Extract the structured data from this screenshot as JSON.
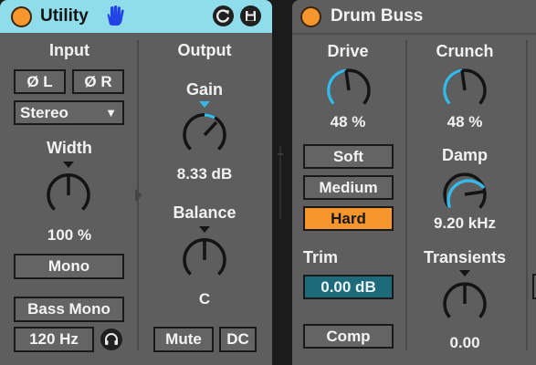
{
  "colors": {
    "accent": "#f7962d",
    "knob_arc": "#37b8e6",
    "header_utility": "#8fdcea",
    "header_drum": "#5e5e5e",
    "panel": "#5e5e5e",
    "teal_field": "#1c6a7a"
  },
  "utility": {
    "title": "Utility",
    "icons": [
      "power-icon",
      "hand-icon",
      "reset-icon",
      "save-icon"
    ],
    "input_label": "Input",
    "phase_left": "Ø L",
    "phase_right": "Ø R",
    "channel_mode": "Stereo",
    "width_label": "Width",
    "width_value": "100 %",
    "mono_button": "Mono",
    "bass_mono_button": "Bass Mono",
    "bass_mono_freq": "120 Hz",
    "output_label": "Output",
    "gain_label": "Gain",
    "gain_value": "8.33 dB",
    "balance_label": "Balance",
    "balance_value": "C",
    "mute_button": "Mute",
    "dc_button": "DC"
  },
  "drum_buss": {
    "title": "Drum Buss",
    "drive_label": "Drive",
    "drive_value": "48 %",
    "soft_button": "Soft",
    "medium_button": "Medium",
    "hard_button": "Hard",
    "selected_mode": "Hard",
    "trim_label": "Trim",
    "trim_value": "0.00 dB",
    "comp_button": "Comp",
    "crunch_label": "Crunch",
    "crunch_value": "48 %",
    "damp_label": "Damp",
    "damp_value": "9.20 kHz",
    "transients_label": "Transients",
    "transients_value": "0.00"
  }
}
